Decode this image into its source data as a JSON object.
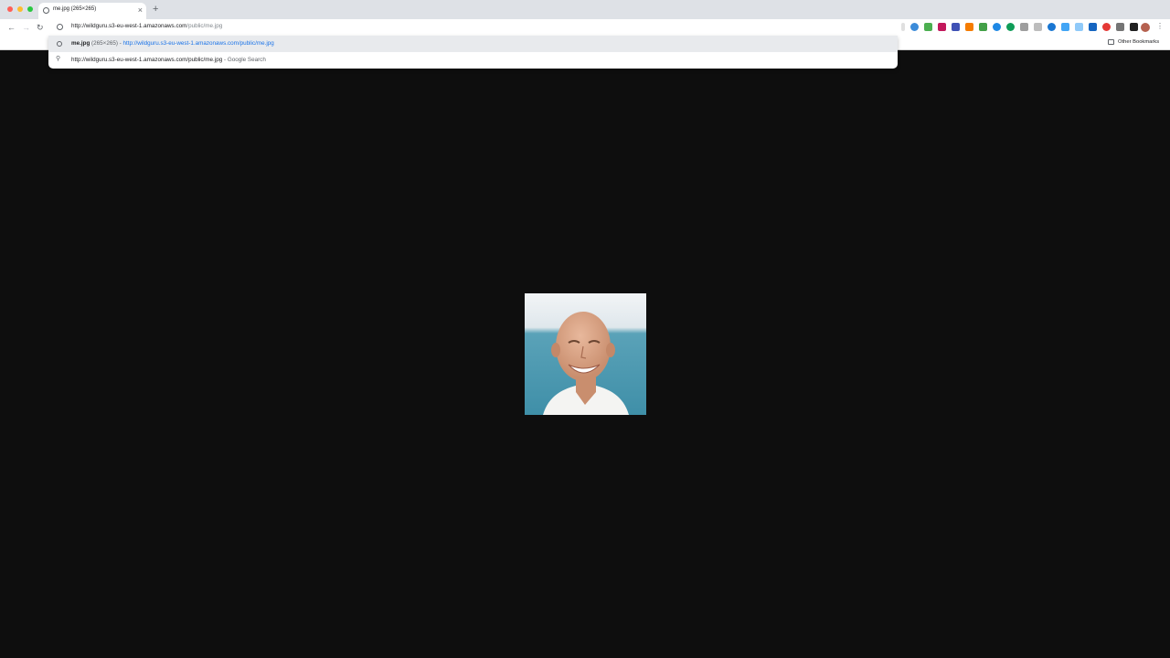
{
  "tab": {
    "title": "me.jpg (265×265)",
    "close": "×",
    "new_tab": "+"
  },
  "toolbar": {
    "back": "←",
    "forward": "→",
    "reload": "↻",
    "omnibox_text_main": "http://wildguru.s3-eu-west-1.amazonaws.com",
    "omnibox_text_path": "/public/me.jpg",
    "menu": "⋮"
  },
  "bookmarks": {
    "other": "Other Bookmarks"
  },
  "suggestions": [
    {
      "title": "me.jpg",
      "dims": "(265×265)",
      "sep": " - ",
      "url": "http://wildguru.s3-eu-west-1.amazonaws.com/public/me.jpg"
    },
    {
      "query": "http://wildguru.s3-eu-west-1.amazonaws.com/public/me.jpg",
      "sep": " - ",
      "engine": "Google Search"
    }
  ],
  "colors": {
    "page_bg": "#0e0e0e",
    "link": "#1a73e8"
  }
}
